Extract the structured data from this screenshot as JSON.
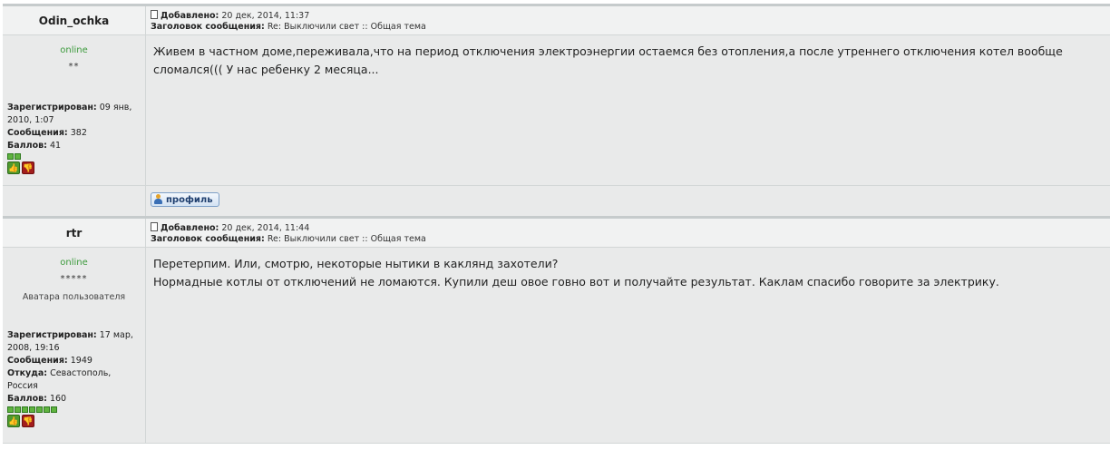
{
  "posts": [
    {
      "author": "Odin_ochka",
      "added_label": "Добавлено:",
      "added_value": "20 дек, 2014, 11:37",
      "subject_label": "Заголовок сообщения:",
      "subject_value": "Re: Выключили свет :: Общая тема",
      "status": "online",
      "stars": "**",
      "registered_label": "Зарегистрирован:",
      "registered_value": "09 янв, 2010, 1:07",
      "messages_label": "Сообщения:",
      "messages_value": "382",
      "points_label": "Баллов:",
      "points_value": "41",
      "rating_pips": 2,
      "text": "Живем в частном доме,переживала,что на период отключения электроэнергии остаемся без отопления,а после утреннего отключения котел вообще сломался((( У нас ребенку 2 месяца...",
      "profile_label": "профиль"
    },
    {
      "author": "rtr",
      "added_label": "Добавлено:",
      "added_value": "20 дек, 2014, 11:44",
      "subject_label": "Заголовок сообщения:",
      "subject_value": "Re: Выключили свет :: Общая тема",
      "status": "online",
      "stars": "*****",
      "avatar_label": "Аватара пользователя",
      "registered_label": "Зарегистрирован:",
      "registered_value": "17 мар, 2008, 19:16",
      "messages_label": "Сообщения:",
      "messages_value": "1949",
      "from_label": "Откуда:",
      "from_value": "Севастополь, Россия",
      "points_label": "Баллов:",
      "points_value": "160",
      "rating_pips": 7,
      "text_line1": "Перетерпим. Или, смотрю, некоторые нытики в каклянд захотели?",
      "text_line2": "Нормадные котлы от отключений не ломаются. Купили деш овое говно вот и получайте результат. Каклам спасибо говорите за электрику."
    }
  ],
  "colors": {
    "online": "#3c9a3c",
    "pip": "#5fb33f",
    "vote_up": "#4e9a2e",
    "vote_down": "#a21d1d",
    "profile_button": "#d3e2f3"
  }
}
